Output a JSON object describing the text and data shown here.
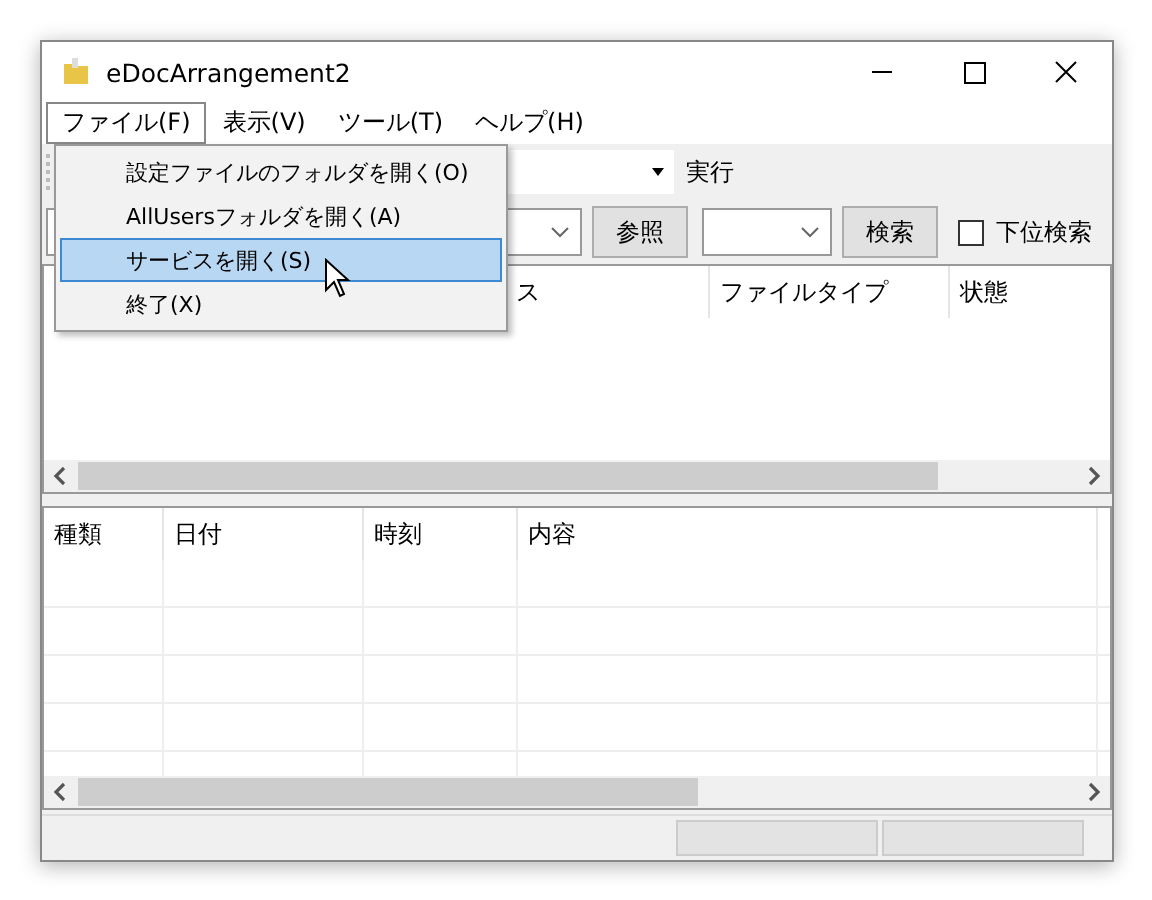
{
  "window": {
    "title": "eDocArrangement2"
  },
  "menu_bar": [
    {
      "label": "ファイル(F)",
      "selected": true
    },
    {
      "label": "表示(V)",
      "selected": false
    },
    {
      "label": "ツール(T)",
      "selected": false
    },
    {
      "label": "ヘルプ(H)",
      "selected": false
    }
  ],
  "file_menu": {
    "items": [
      {
        "label": "設定ファイルのフォルダを開く(O)",
        "selected": false
      },
      {
        "label": "AllUsersフォルダを開く(A)",
        "selected": false
      },
      {
        "label": "サービスを開く(S)",
        "selected": true
      },
      {
        "label": "終了(X)",
        "selected": false
      }
    ]
  },
  "toolbar": {
    "run_label": "実行",
    "browse_button": "参照",
    "search_button": "検索",
    "subfolder_checkbox": {
      "label": "下位検索",
      "checked": false
    }
  },
  "file_list": {
    "columns": [
      "ス",
      "ファイルタイプ",
      "状態"
    ]
  },
  "log_list": {
    "columns": [
      "種類",
      "日付",
      "時刻",
      "内容"
    ]
  }
}
